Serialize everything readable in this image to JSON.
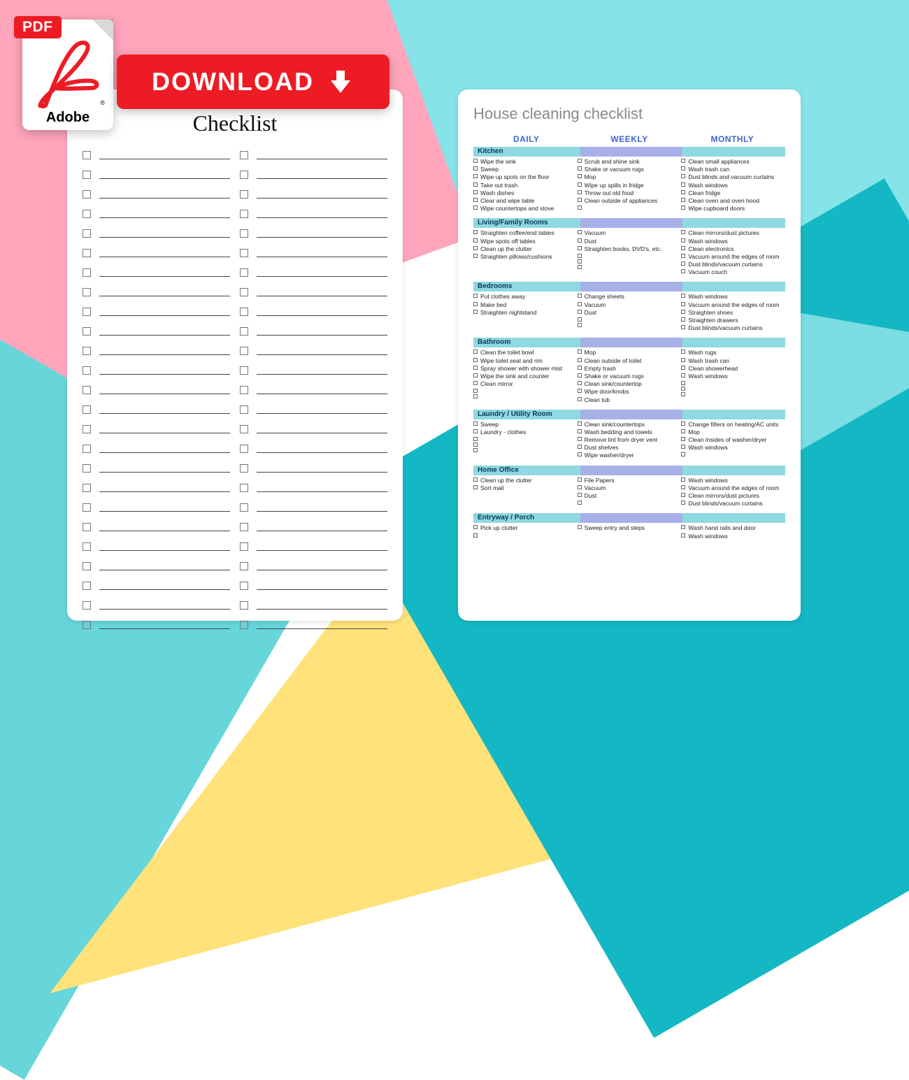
{
  "badge": {
    "pdf": "PDF",
    "adobe": "Adobe",
    "reg": "®"
  },
  "download": {
    "label": "DOWNLOAD"
  },
  "left": {
    "title": "Checklist",
    "rows_per_col": 25,
    "cols": 2
  },
  "right": {
    "title": "House cleaning checklist",
    "frequencies": [
      "DAILY",
      "WEEKLY",
      "MONTHLY"
    ],
    "sections": [
      {
        "name": "Kitchen",
        "daily": [
          "Wipe the sink",
          "Sweep",
          "Wipe up spots on the floor",
          "Take out trash",
          "Wash dishes",
          "Clear and wipe table",
          "Wipe countertops and stove"
        ],
        "weekly": [
          "Scrub and shine sink",
          "Shake or vacuum rugs",
          "Mop",
          "Wipe up spills in fridge",
          "Throw out old food",
          "Clean outside of appliances",
          ""
        ],
        "monthly": [
          "Clean small appliances",
          "Wash trash can",
          "Dust blinds and vacuum curtains",
          "Wash windows",
          "Clean fridge",
          "Clean oven and oven hood",
          "Wipe cupboard doors"
        ]
      },
      {
        "name": "Living/Family Rooms",
        "daily": [
          "Straighten coffee/end tables",
          "Wipe spots off tables",
          "Clean up the clutter",
          "Straighten pillows/cushions"
        ],
        "weekly": [
          "Vacuum",
          "Dust",
          "Straighten books, DVD's, etc.",
          "",
          "",
          ""
        ],
        "monthly": [
          "Clean mirrors/dust pictures",
          "Wash windows",
          "Clean electronics",
          "Vacuum around the edges of room",
          "Dust blinds/vacuum curtains",
          "Vacuum couch"
        ]
      },
      {
        "name": "Bedrooms",
        "daily": [
          "Put clothes away",
          "Make bed",
          "Straighten nightstand"
        ],
        "weekly": [
          "Change sheets",
          "Vacuum",
          "Dust",
          "",
          ""
        ],
        "monthly": [
          "Wash windows",
          "Vacuum around the edges of room",
          "Straighten shoes",
          "Straighten drawers",
          "Dust blinds/vacuum curtains"
        ]
      },
      {
        "name": "Bathroom",
        "daily": [
          "Clean the toilet bowl",
          "Wipe toilet seat and rim",
          "Spray shower with shower mist",
          "Wipe the sink and counter",
          "Clean mirror",
          "",
          ""
        ],
        "weekly": [
          "Mop",
          "Clean outside of toilet",
          "Empty trash",
          "Shake or vacuum rugs",
          "Clean sink/countertop",
          "Wipe door/knobs",
          "Clean tub"
        ],
        "monthly": [
          "Wash rugs",
          "Wash trash can",
          "Clean showerhead",
          "Wash windows",
          "",
          "",
          ""
        ]
      },
      {
        "name": "Laundry / Utility Room",
        "daily": [
          "Sweep",
          "Laundry - clothes",
          "",
          "",
          ""
        ],
        "weekly": [
          "Clean sink/countertops",
          "Wash bedding and towels",
          "Remove lint from dryer vent",
          "Dust shelves",
          "Wipe washer/dryer"
        ],
        "monthly": [
          "Change filters on heating/AC units",
          "Mop",
          "Clean insides of washer/dryer",
          "Wash windows",
          ""
        ]
      },
      {
        "name": "Home Office",
        "daily": [
          "Clean up the clutter",
          "Sort mail"
        ],
        "weekly": [
          "File Papers",
          "Vacuum",
          "Dust",
          ""
        ],
        "monthly": [
          "Wash windows",
          "Vacuum around the edges of room",
          "Clean mirrors/dust pictures",
          "Dust blinds/vacuum curtains"
        ]
      },
      {
        "name": "Entryway / Porch",
        "daily": [
          "Pick up clutter",
          ""
        ],
        "weekly": [
          "Sweep entry and steps"
        ],
        "monthly": [
          "Wash hand rails and door",
          "Wash windows"
        ]
      }
    ]
  }
}
